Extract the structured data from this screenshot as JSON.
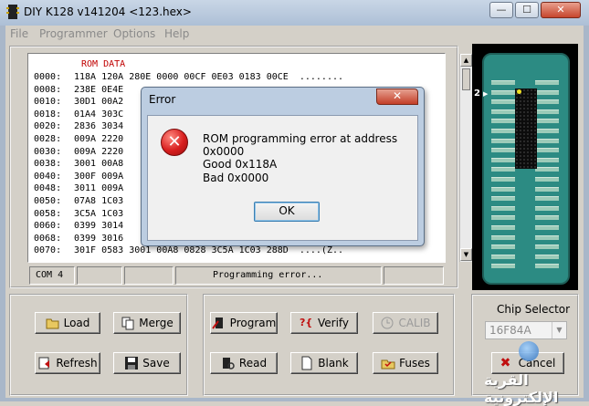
{
  "window": {
    "title": "DIY K128 v141204  <123.hex>",
    "minimize": "—",
    "maximize": "☐",
    "close": "✕"
  },
  "menu": [
    "File",
    "Programmer",
    "Options",
    "Help"
  ],
  "hex": {
    "header": "ROM DATA",
    "lines": [
      {
        "addr": "0000:",
        "data": "118A 120A 280E 0000 00CF 0E03 0183 00CE  ........"
      },
      {
        "addr": "0008:",
        "data": "238E 0E4E"
      },
      {
        "addr": "0010:",
        "data": "30D1 00A2"
      },
      {
        "addr": "0018:",
        "data": "01A4 303C"
      },
      {
        "addr": "0020:",
        "data": "2836 3034"
      },
      {
        "addr": "0028:",
        "data": "009A 2220"
      },
      {
        "addr": "0030:",
        "data": "009A 2220"
      },
      {
        "addr": "0038:",
        "data": "3001 00A8"
      },
      {
        "addr": "0040:",
        "data": "300F 009A"
      },
      {
        "addr": "0048:",
        "data": "3011 009A"
      },
      {
        "addr": "0050:",
        "data": "07A8 1C03"
      },
      {
        "addr": "0058:",
        "data": "3C5A 1C03"
      },
      {
        "addr": "0060:",
        "data": "0399 3014"
      },
      {
        "addr": "0068:",
        "data": "0399 3016"
      },
      {
        "addr": "0070:",
        "data": "301F 0583 3001 00A8 0828 3C5A 1C03 288D  ....(Z.."
      }
    ]
  },
  "status": {
    "port": "COM 4",
    "message": "Programming error..."
  },
  "pins": {
    "number": "2"
  },
  "buttons": {
    "load": "Load",
    "merge": "Merge",
    "refresh": "Refresh",
    "save": "Save",
    "program": "Program",
    "verify": "Verify",
    "calib": "CALIB",
    "read": "Read",
    "blank": "Blank",
    "fuses": "Fuses",
    "cancel": "Cancel"
  },
  "chip_selector": {
    "label": "Chip Selector",
    "selected": "16F84A"
  },
  "dialog": {
    "title": "Error",
    "close": "✕",
    "message": "ROM programming error at address 0x0000",
    "good": "Good  0x118A",
    "bad": "Bad 0x0000",
    "ok": "OK"
  },
  "watermark": "القرية الإلكترونية",
  "colors": {
    "board": "#2c8b83",
    "error_red": "#d81e1e",
    "rom_header": "#c00000"
  }
}
